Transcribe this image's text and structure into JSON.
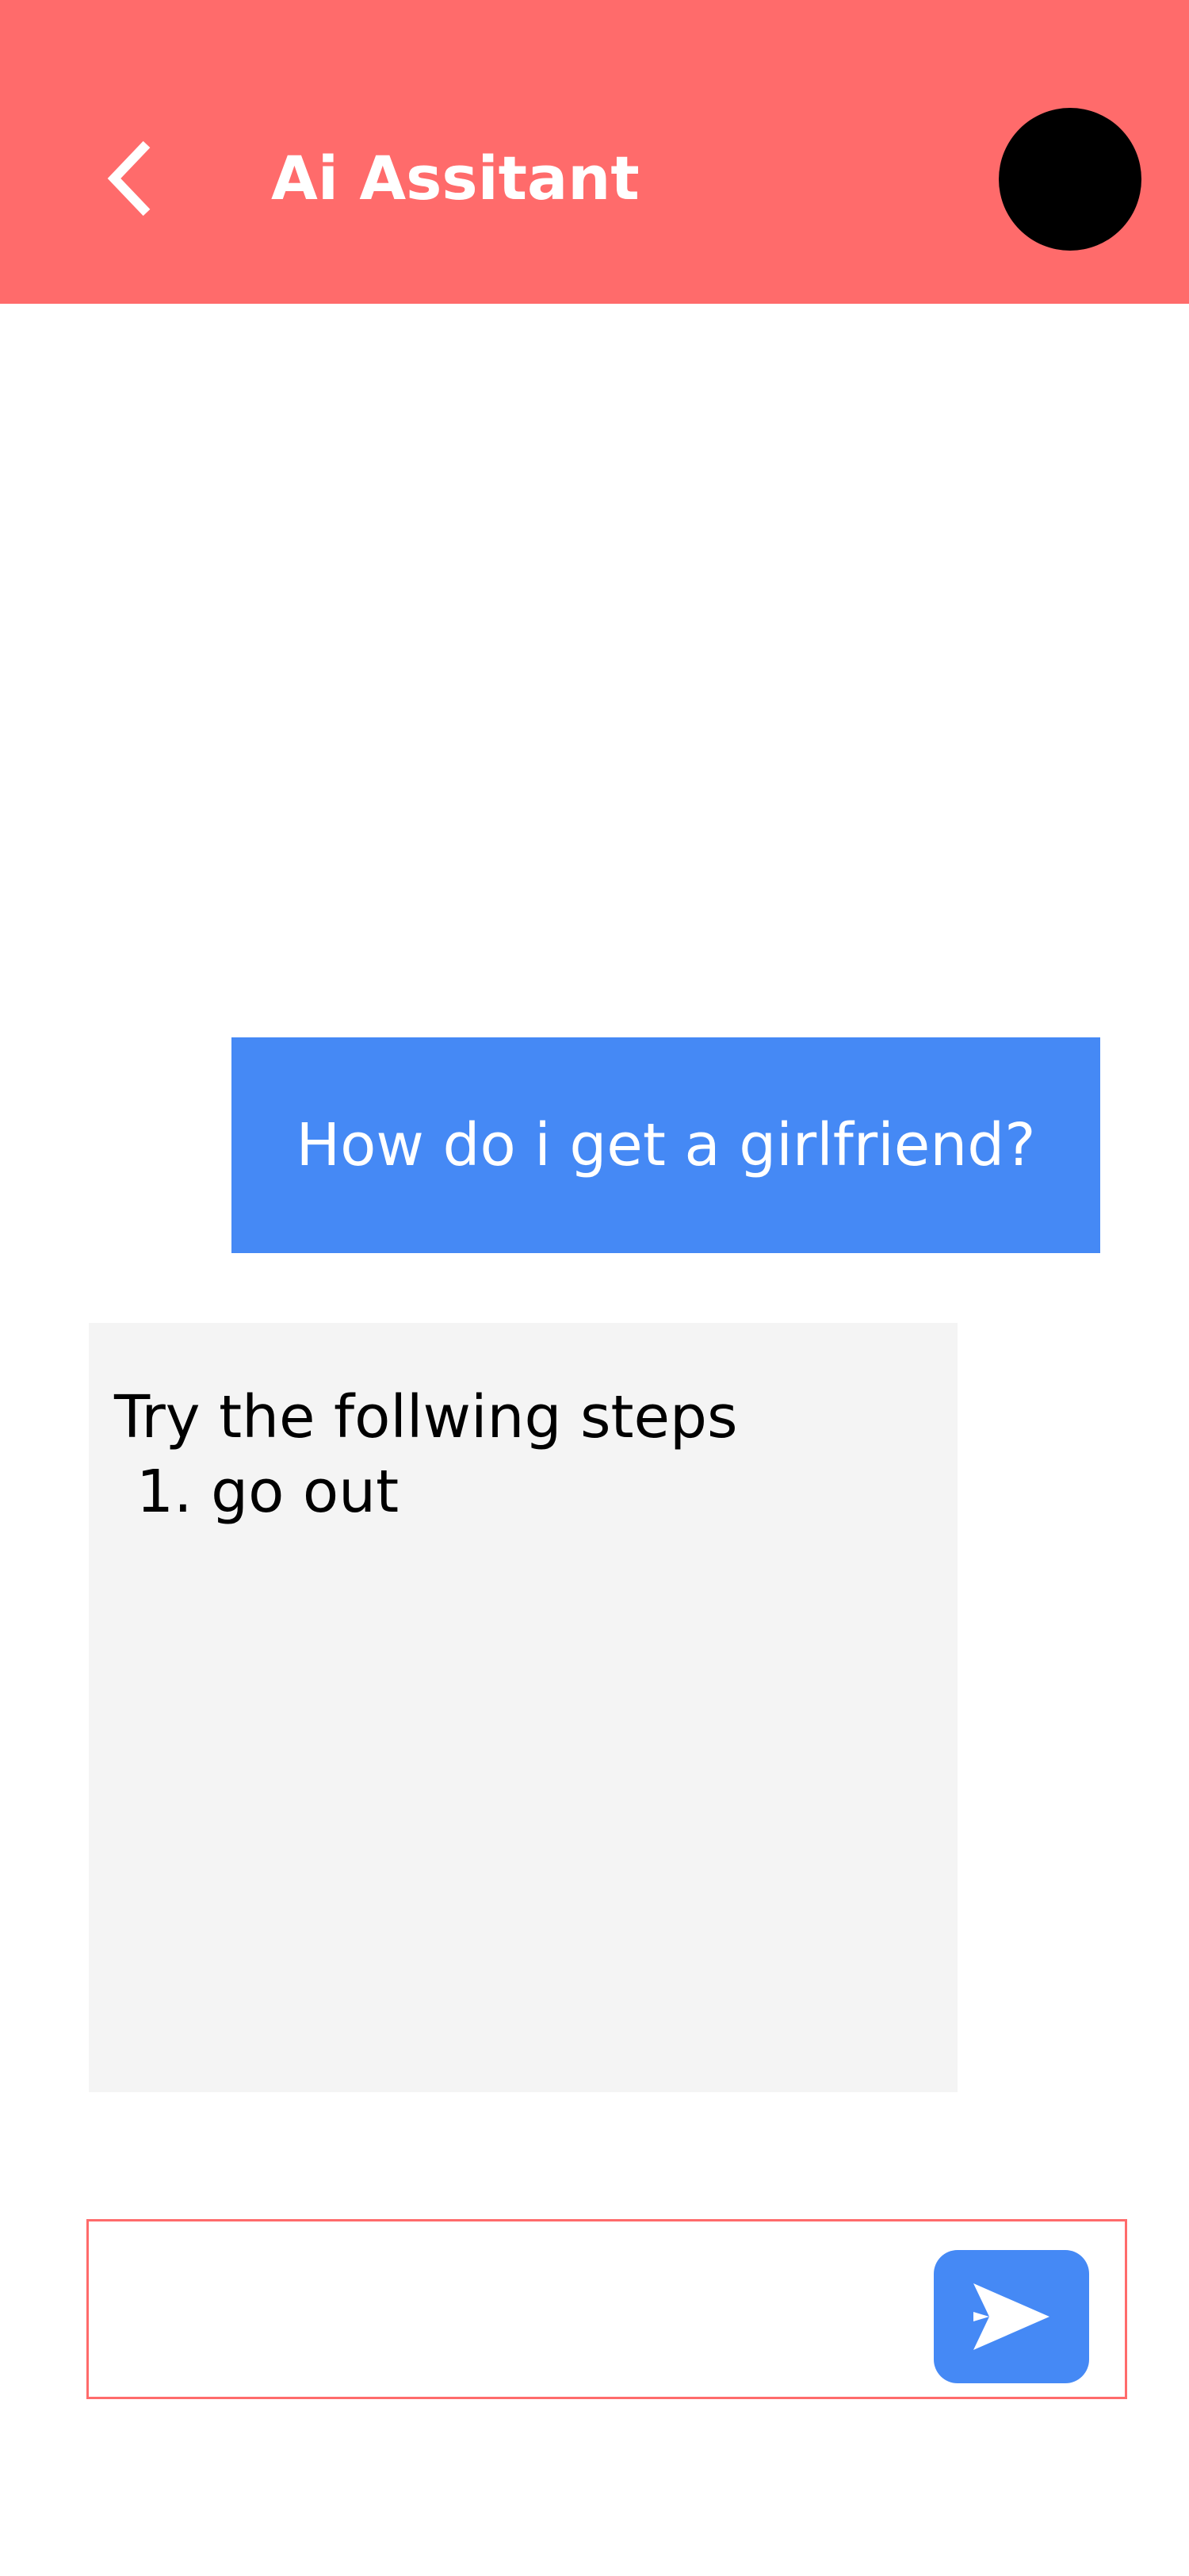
{
  "header": {
    "title": "Ai Assitant",
    "back_icon": "chevron-left-icon",
    "avatar": "avatar"
  },
  "messages": [
    {
      "role": "user",
      "text": "How do i get a girlfriend?"
    },
    {
      "role": "assistant",
      "lines": [
        "Try the follwing steps",
        "1. go out"
      ]
    }
  ],
  "composer": {
    "value": "",
    "placeholder": "",
    "send_icon": "send-icon"
  },
  "colors": {
    "header": "#FF6B6B",
    "user_bubble": "#4589F5",
    "assistant_bubble": "#F4F4F4",
    "input_border": "#FF6B6B",
    "send_button": "#4589F5"
  }
}
